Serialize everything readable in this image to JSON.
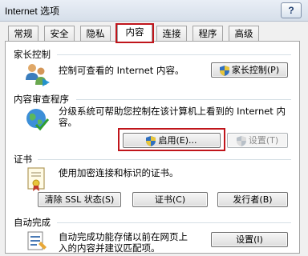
{
  "window": {
    "title": "Internet 选项",
    "help_label": "?"
  },
  "tabs": [
    "常规",
    "安全",
    "隐私",
    "内容",
    "连接",
    "程序",
    "高级"
  ],
  "parental": {
    "title": "家长控制",
    "description": "控制可查看的 Internet 内容。",
    "button": "家长控制(P)"
  },
  "advisor": {
    "title": "内容审查程序",
    "description_1": "分级系统可帮助您控制在该计算机上看到的 Internet 内",
    "description_2": "容。",
    "enable_button": "启用(E)...",
    "settings_button": "设置(T)"
  },
  "certificates": {
    "title": "证书",
    "description": "使用加密连接和标识的证书。",
    "clear_ssl_button": "清除 SSL 状态(S)",
    "certificates_button": "证书(C)",
    "publishers_button": "发行者(B)"
  },
  "autocomplete": {
    "title": "自动完成",
    "description_1": "自动完成功能存储以前在网页上",
    "description_2": "入的内容并建议匹配项。",
    "settings_button": "设置(I)"
  }
}
